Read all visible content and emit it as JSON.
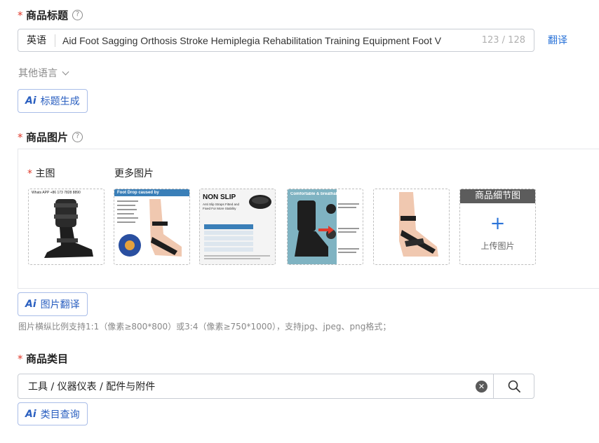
{
  "title_section": {
    "required_mark": "*",
    "label": "商品标题",
    "help_glyph": "?",
    "language": "英语",
    "value": "Aid Foot Sagging Orthosis Stroke Hemiplegia Rehabilitation Training Equipment Foot V",
    "counter": "123 / 128",
    "translate_link": "翻译",
    "other_languages": "其他语言",
    "ai_icon": "Ai",
    "ai_button": "标题生成"
  },
  "image_section": {
    "required_mark": "*",
    "label": "商品图片",
    "help_glyph": "?",
    "main_required_mark": "*",
    "main_label": "主图",
    "more_label": "更多图片",
    "thumbnails": [
      {
        "caption": "Whats APP +86 173 7828 8890"
      },
      {
        "caption": "Foot Drop caused by"
      },
      {
        "caption": "NON SLIP",
        "sub": "Anti Slip Straps Fitted and Fixed For More Stability"
      },
      {
        "caption": "Comfortable & breathable lining"
      },
      {
        "caption": ""
      }
    ],
    "detail_tile": {
      "header": "商品细节图",
      "plus": "+",
      "upload": "上传图片"
    },
    "ai_icon": "Ai",
    "ai_button": "图片翻译",
    "hint": "图片横纵比例支持1:1（像素≥800*800）或3:4（像素≥750*1000），支持jpg、jpeg、png格式；"
  },
  "category_section": {
    "required_mark": "*",
    "label": "商品类目",
    "value": "工具 / 仪器仪表 / 配件与附件",
    "clear_glyph": "✕",
    "ai_icon": "Ai",
    "ai_button": "类目查询"
  },
  "colors": {
    "required": "#e03b2c",
    "link": "#2a73d8",
    "ai_border": "#a9bde8",
    "detail_header": "#5c5c5c"
  }
}
